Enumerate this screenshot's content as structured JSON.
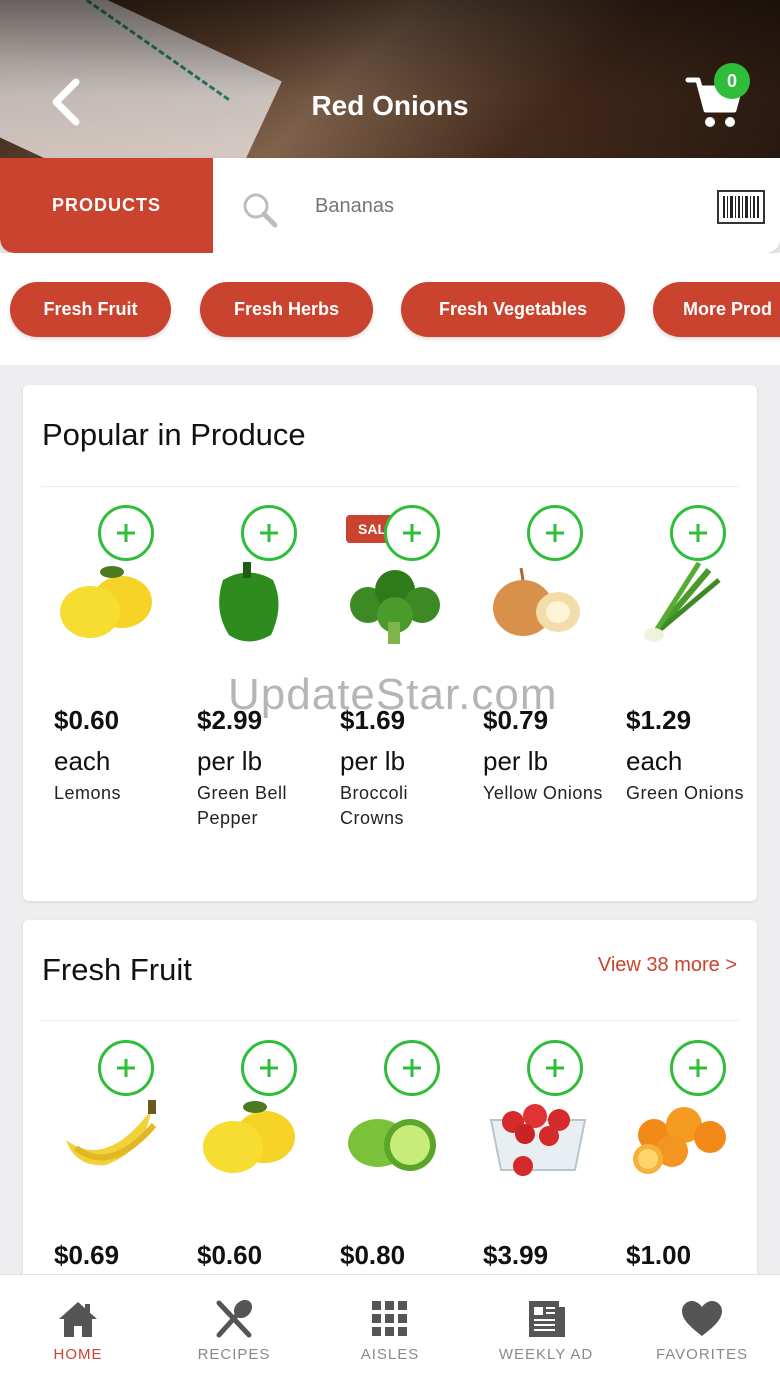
{
  "header": {
    "title": "Red Onions",
    "cart_count": "0"
  },
  "search": {
    "products_label": "PRODUCTS",
    "placeholder": "Bananas"
  },
  "categories": [
    "Fresh Fruit",
    "Fresh Herbs",
    "Fresh Vegetables",
    "More Prod"
  ],
  "popular": {
    "title": "Popular in Produce",
    "items": [
      {
        "price": "$0.60",
        "unit": "each",
        "name": "Lemons",
        "icon": "lemon"
      },
      {
        "price": "$2.99",
        "unit": "per lb",
        "name": "Green Bell Pepper",
        "icon": "bell-pepper"
      },
      {
        "price": "$1.69",
        "unit": "per lb",
        "name": "Broccoli Crowns",
        "icon": "broccoli",
        "badge": "SAL"
      },
      {
        "price": "$0.79",
        "unit": "per lb",
        "name": "Yellow Onions",
        "icon": "onion"
      },
      {
        "price": "$1.29",
        "unit": "each",
        "name": "Green Onions",
        "icon": "green-onion"
      }
    ]
  },
  "fresh_fruit": {
    "title": "Fresh Fruit",
    "view_more": "View 38 more >",
    "items": [
      {
        "price": "$0.69",
        "icon": "banana"
      },
      {
        "price": "$0.60",
        "icon": "lemon"
      },
      {
        "price": "$0.80",
        "icon": "lime"
      },
      {
        "price": "$3.99",
        "icon": "strawberry"
      },
      {
        "price": "$1.00",
        "icon": "orange"
      }
    ]
  },
  "watermark": "UpdateStar.com",
  "tabs": [
    {
      "label": "HOME",
      "icon": "home",
      "active": true
    },
    {
      "label": "RECIPES",
      "icon": "utensils",
      "active": false
    },
    {
      "label": "AISLES",
      "icon": "grid",
      "active": false
    },
    {
      "label": "WEEKLY AD",
      "icon": "newspaper",
      "active": false
    },
    {
      "label": "FAVORITES",
      "icon": "heart",
      "active": false
    }
  ],
  "colors": {
    "accent": "#c9432e",
    "add_green": "#2fbe3a"
  }
}
